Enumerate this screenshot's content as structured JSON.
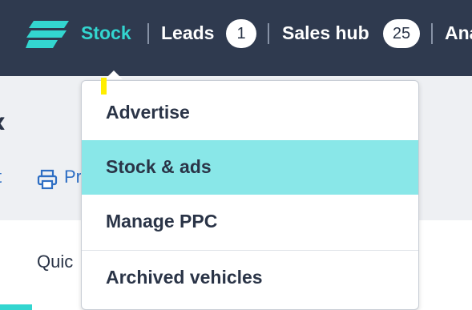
{
  "nav": {
    "logo_icon": "brand-logo-icon",
    "items": [
      {
        "label": "Stock",
        "active": true
      },
      {
        "label": "Leads",
        "badge": "1"
      },
      {
        "label": "Sales hub",
        "badge": "25"
      },
      {
        "label": "Ana"
      }
    ],
    "accent_color": "#33d6d0",
    "bar_color": "#2f3a4f"
  },
  "background": {
    "back_glyph": "‹",
    "partial_link": "t",
    "print_label": "Pr",
    "print_icon": "printer-icon",
    "tab_label": "Quic"
  },
  "dropdown": {
    "items": [
      {
        "label": "Advertise"
      },
      {
        "label": "Stock & ads",
        "highlighted": true
      },
      {
        "label": "Manage PPC"
      },
      {
        "label": "Archived vehicles"
      }
    ],
    "highlight_color": "#89e7e8"
  }
}
